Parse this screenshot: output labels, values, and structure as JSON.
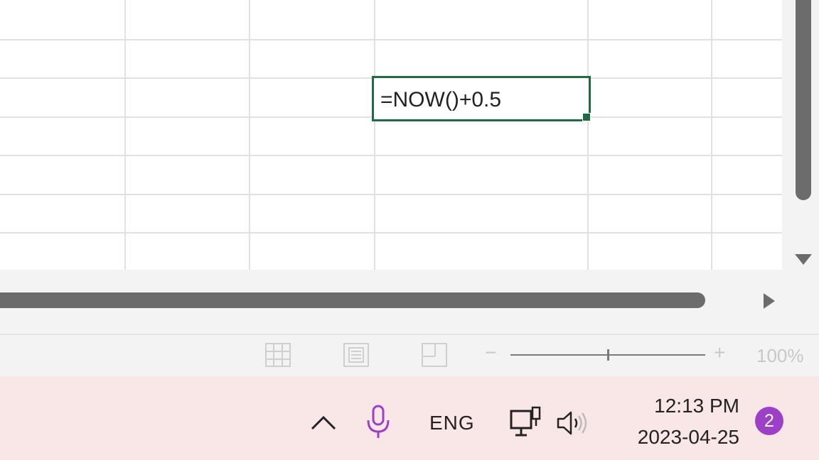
{
  "sheet": {
    "active_cell_formula": "=NOW()+0.5"
  },
  "status_bar": {
    "views": [
      "normal-view",
      "page-layout-view",
      "page-break-preview"
    ],
    "zoom_minus": "−",
    "zoom_plus": "+",
    "zoom_level": "100%",
    "zoom_fraction": 0.5
  },
  "taskbar": {
    "language": "ENG",
    "time": "12:13 PM",
    "date": "2023-04-25",
    "notification_count": "2",
    "icons": [
      "chevron-up-icon",
      "microphone-icon",
      "network-icon",
      "speaker-icon"
    ]
  },
  "colors": {
    "active_cell_border": "#1e6b44",
    "notification_badge": "#9e3fc7",
    "taskbar_bg": "#f9e6e7",
    "scrollbar_thumb": "#6c6c6c"
  }
}
